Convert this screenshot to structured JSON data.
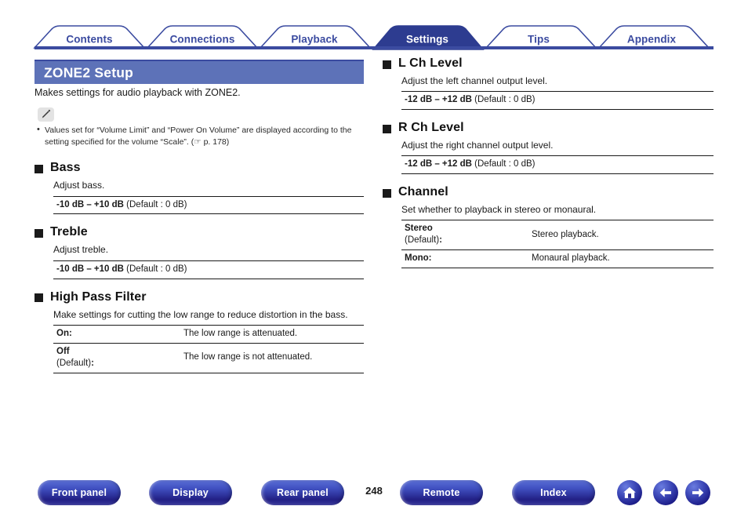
{
  "tabs": [
    {
      "label": "Contents",
      "active": false
    },
    {
      "label": "Connections",
      "active": false
    },
    {
      "label": "Playback",
      "active": false
    },
    {
      "label": "Settings",
      "active": true
    },
    {
      "label": "Tips",
      "active": false
    },
    {
      "label": "Appendix",
      "active": false
    }
  ],
  "page": {
    "title": "ZONE2 Setup",
    "intro": "Makes settings for audio playback with ZONE2.",
    "number": "248"
  },
  "note": {
    "icon": "pencil-icon",
    "items": [
      "Values set for “Volume Limit” and “Power On Volume” are displayed according to the setting specified for the volume “Scale”.  (☞ p. 178)"
    ]
  },
  "left_sections": [
    {
      "title": "Bass",
      "desc": "Adjust bass.",
      "range_bold": "-10 dB – +10 dB",
      "range_rest": " (Default : 0 dB)"
    },
    {
      "title": "Treble",
      "desc": "Adjust treble.",
      "range_bold": "-10 dB – +10 dB",
      "range_rest": " (Default : 0 dB)"
    },
    {
      "title": "High Pass Filter",
      "desc": "Make settings for cutting the low range to reduce distortion in the bass.",
      "rows": [
        {
          "key": "On",
          "key_sub": "",
          "value": "The low range is attenuated."
        },
        {
          "key": "Off",
          "key_sub": "(Default)",
          "value": "The low range is not attenuated."
        }
      ]
    }
  ],
  "right_sections": [
    {
      "title": "L Ch Level",
      "desc": "Adjust the left channel output level.",
      "range_bold": "-12 dB – +12 dB",
      "range_rest": " (Default : 0 dB)"
    },
    {
      "title": "R Ch Level",
      "desc": "Adjust the right channel output level.",
      "range_bold": "-12 dB – +12 dB",
      "range_rest": " (Default : 0 dB)"
    },
    {
      "title": "Channel",
      "desc": "Set whether to playback in stereo or monaural.",
      "rows": [
        {
          "key": "Stereo",
          "key_sub": "(Default)",
          "value": "Stereo playback."
        },
        {
          "key": "Mono",
          "key_sub": "",
          "value": "Monaural playback."
        }
      ]
    }
  ],
  "footer": {
    "buttons": [
      {
        "label": "Front panel"
      },
      {
        "label": "Display"
      },
      {
        "label": "Rear panel"
      },
      {
        "label": "Remote"
      },
      {
        "label": "Index"
      }
    ],
    "icons": [
      {
        "name": "home-icon"
      },
      {
        "name": "arrow-left-icon"
      },
      {
        "name": "arrow-right-icon"
      }
    ]
  },
  "colors": {
    "tab_active_fill": "#2d3c90",
    "tab_outline": "#3b4ba0",
    "title_bar": "#5d72b8",
    "rule": "#1a1a1a"
  }
}
